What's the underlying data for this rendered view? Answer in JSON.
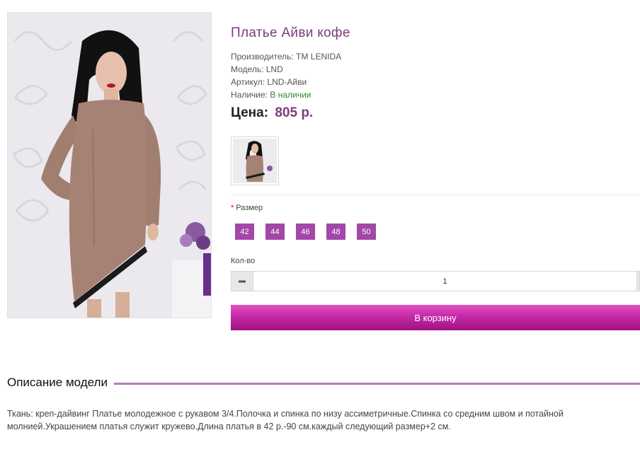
{
  "product": {
    "title": "Платье Айви кофе",
    "manufacturer_label": "Производитель:",
    "manufacturer": "TM LENIDA",
    "model_label": "Модель:",
    "model": "LND",
    "sku_label": "Артикул:",
    "sku": "LND-Айви",
    "availability_label": "Наличие:",
    "availability": "В наличии",
    "price_label": "Цена:",
    "price": "805 р."
  },
  "options": {
    "size_required_mark": "*",
    "size_label": "Размер",
    "sizes": [
      "42",
      "44",
      "46",
      "48",
      "50"
    ]
  },
  "quantity": {
    "label": "Кол-во",
    "value": "1",
    "minus_icon": "minus-icon"
  },
  "cart": {
    "button_label": "В корзину"
  },
  "description": {
    "heading": "Описание модели",
    "text": "Ткань: креп-дайвинг Платье молодежное с рукавом 3/4.Полочка и спинка по низу ассиметричные.Спинка со средним швом и потайной молнией.Украшением платья служит кружево.Длина платья в 42 р.-90 см.каждый следующий размер+2 см."
  },
  "colors": {
    "accent": "#a347a8",
    "title": "#7a3d7f",
    "in_stock": "#2e8a2e",
    "cart_button": "#c42aa6",
    "description_rule": "#b57ab9"
  }
}
